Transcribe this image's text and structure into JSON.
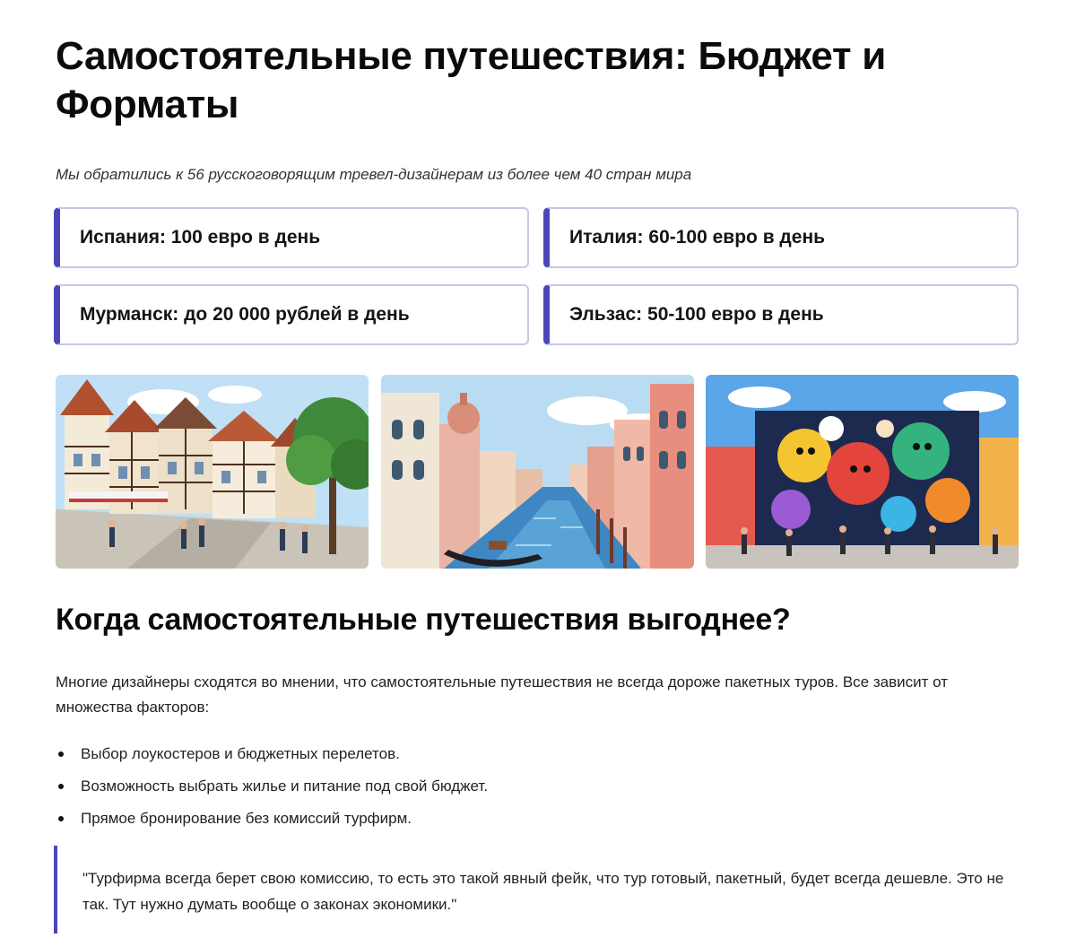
{
  "article": {
    "title": "Самостоятельные путешествия: Бюджет и Форматы",
    "subtitle": "Мы обратились к 56 русскоговорящим тревел-дизайнерам из более чем 40 стран мира",
    "budget_cards": [
      "Испания: 100 евро в день",
      "Италия: 60-100 евро в день",
      "Мурманск: до 20 000 рублей в день",
      "Эльзас: 50-100 евро в день"
    ],
    "images": [
      "half-timbered-town-illustration",
      "venice-canal-illustration",
      "street-mural-illustration"
    ],
    "section_heading": "Когда самостоятельные путешествия выгоднее?",
    "section_text": "Многие дизайнеры сходятся во мнении, что самостоятельные путешествия не всегда дороже пакетных туров. Все зависит от множества факторов:",
    "bullets": [
      "Выбор лоукостеров и бюджетных перелетов.",
      "Возможность выбрать жилье и питание под свой бюджет.",
      "Прямое бронирование без комиссий турфирм."
    ],
    "quote": "\"Турфирма всегда берет свою комиссию, то есть это такой явный фейк, что тур готовый, пакетный, будет всегда дешевле. Это не так. Тут нужно думать вообще о законах экономики.\""
  },
  "colors": {
    "accent": "#4b46b8",
    "card_border": "#c9c7e6"
  }
}
